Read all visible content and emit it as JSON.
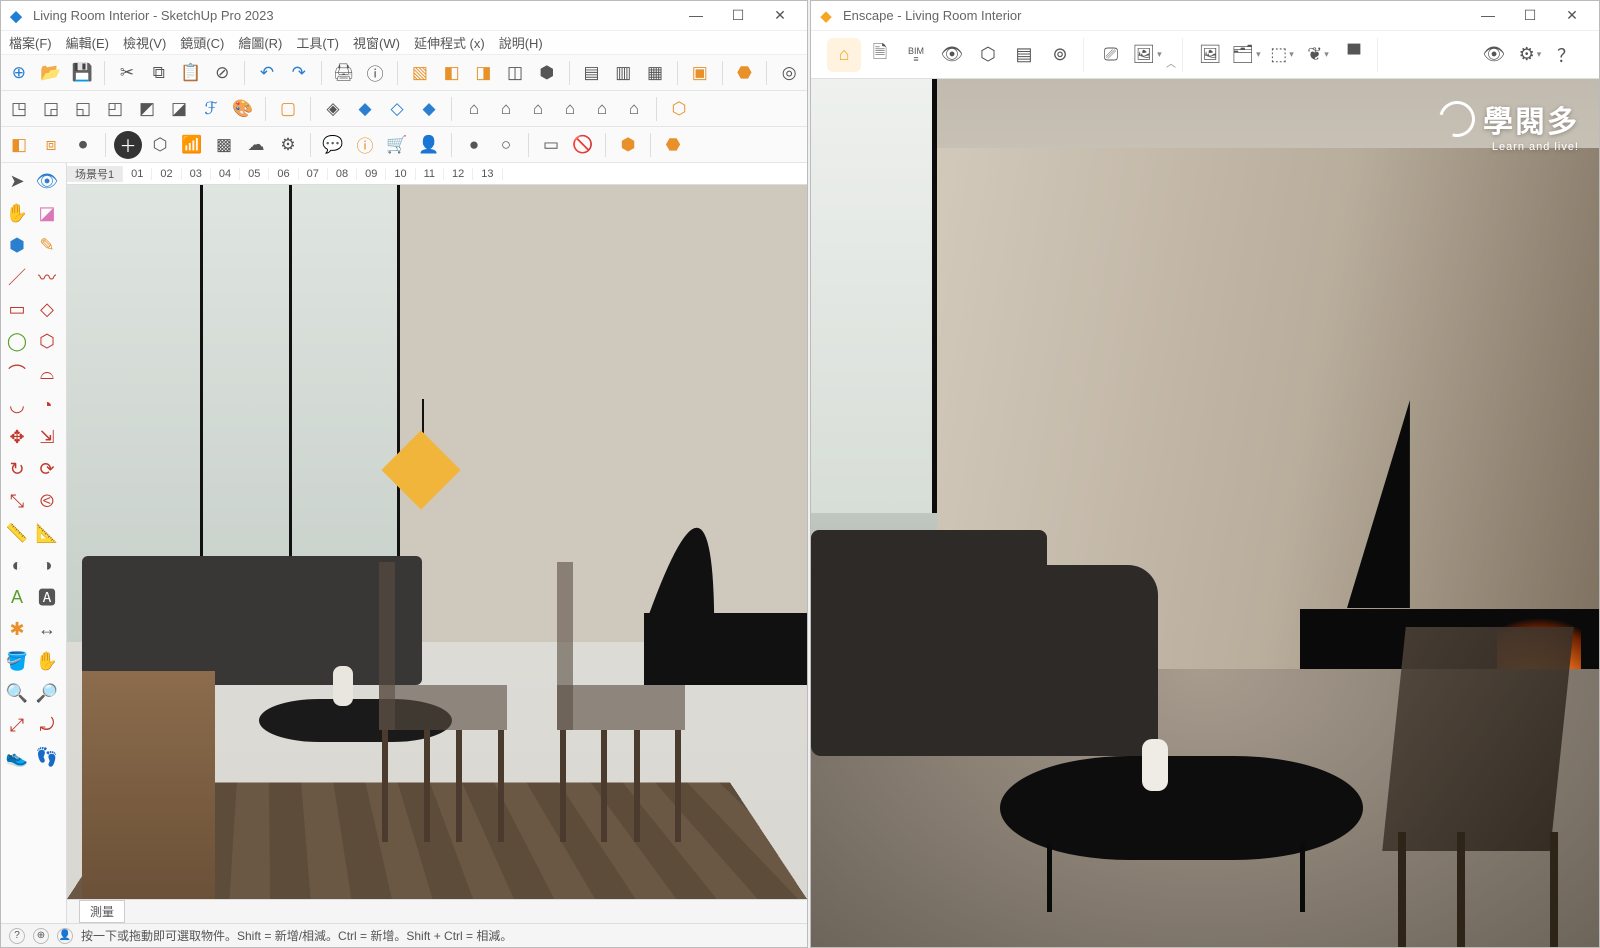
{
  "sketchup": {
    "title": "Living Room Interior - SketchUp Pro 2023",
    "menus": [
      "檔案(F)",
      "編輯(E)",
      "檢視(V)",
      "鏡頭(C)",
      "繪圖(R)",
      "工具(T)",
      "視窗(W)",
      "延伸程式 (x)",
      "說明(H)"
    ],
    "scene_tabs": [
      "场景号1",
      "01",
      "02",
      "03",
      "04",
      "05",
      "06",
      "07",
      "08",
      "09",
      "10",
      "11",
      "12",
      "13"
    ],
    "vcb_label": "測量",
    "status_text": "按一下或拖動即可選取物件。Shift = 新增/相減。Ctrl = 新增。Shift + Ctrl = 相減。",
    "toolbar_row1": [
      "new",
      "open",
      "save",
      "sep",
      "cut",
      "copy",
      "paste",
      "delete",
      "sep",
      "undo",
      "redo",
      "sep",
      "print",
      "sep",
      "model-info",
      "sep",
      "paint",
      "sep",
      "push",
      "follow",
      "offset",
      "outer",
      "sep",
      "section",
      "sep",
      "hide",
      "sep",
      "tag",
      "sep",
      "comp"
    ],
    "toolbar_row2": [
      "cube1",
      "cube2",
      "cube3",
      "cube4",
      "cube5",
      "cube6",
      "script",
      "palette",
      "sep",
      "cube7",
      "sep",
      "iso",
      "front",
      "back",
      "left",
      "sep",
      "house1",
      "house-left",
      "house-front",
      "house-right",
      "house-iso",
      "house-top",
      "sep",
      "shield"
    ],
    "toolbar_row3": [
      "layer",
      "comp-edit",
      "rec",
      "sep",
      "add-dark",
      "hex",
      "rss",
      "checker",
      "cloud",
      "gear",
      "sep",
      "chat",
      "info",
      "cart",
      "user",
      "sep",
      "dot",
      "circle",
      "sep",
      "rect",
      "eye-off",
      "sep",
      "gold1",
      "sep",
      "gold2"
    ],
    "palette": [
      "select",
      "orbit",
      "hand",
      "eraser",
      "comp",
      "pencil",
      "line",
      "freehand",
      "rect",
      "rect-rot",
      "circle",
      "poly",
      "arc",
      "arc2",
      "arc3",
      "pie",
      "move",
      "move-copy",
      "rotate",
      "rotate-copy",
      "scale",
      "scale-copy",
      "offset",
      "offset2",
      "tape",
      "tape2",
      "protractor",
      "text",
      "axes",
      "dim",
      "paint",
      "sample",
      "zoom",
      "zoom-win",
      "zoom-ext",
      "prev",
      "pan",
      "walk",
      "look",
      "section2"
    ]
  },
  "enscape": {
    "title": "Enscape - Living Room Interior",
    "toolbar_groups": [
      [
        "home",
        "page",
        "bim",
        "eye-box",
        "shield",
        "library",
        "video"
      ],
      [
        "capture",
        "image"
      ],
      [
        "img-set",
        "layers",
        "cube",
        "leaf",
        "vr"
      ],
      [
        "eye",
        "settings",
        "help"
      ]
    ]
  },
  "watermark": {
    "cn": "學閱多",
    "en": "Learn and live!"
  }
}
